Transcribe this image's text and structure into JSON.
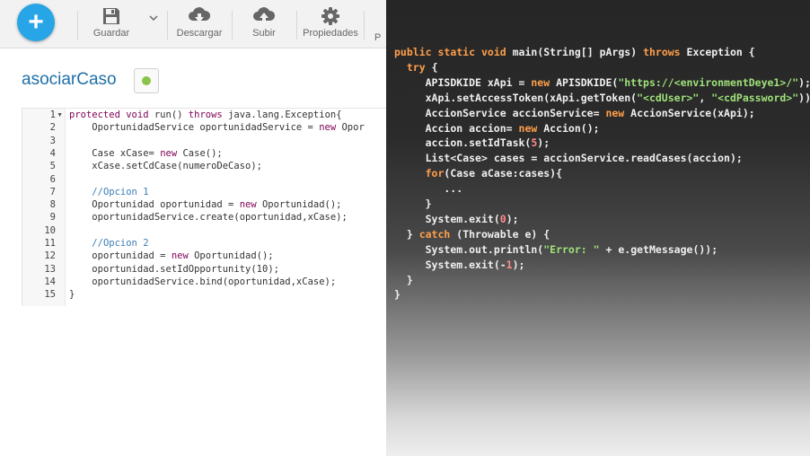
{
  "toolbar": {
    "add_symbol": "+",
    "save_label": "Guardar",
    "download_label": "Descargar",
    "upload_label": "Subir",
    "properties_label": "Propiedades",
    "cut_label": "P"
  },
  "page": {
    "title": "asociarCaso",
    "status_color": "#8bc34a"
  },
  "editor": {
    "line_numbers": [
      "1",
      "2",
      "3",
      "4",
      "5",
      "6",
      "7",
      "8",
      "9",
      "10",
      "11",
      "12",
      "13",
      "14",
      "15"
    ],
    "lines": [
      "protected void run() throws java.lang.Exception{",
      "    OportunidadService oportunidadService = new Opor",
      "",
      "    Case xCase= new Case();",
      "    xCase.setCdCase(numeroDeCaso);",
      "",
      "    //Opcion 1",
      "    Oportunidad oportunidad = new Oportunidad();",
      "    oportunidadService.create(oportunidad,xCase);",
      "",
      "    //Opcion 2",
      "    oportunidad = new Oportunidad();",
      "    oportunidad.setIdOpportunity(10);",
      "    oportunidadService.bind(oportunidad,xCase);",
      "}"
    ]
  },
  "overlay_code": {
    "lines": [
      "public static void main(String[] pArgs) throws Exception {",
      "  try {",
      "     APISDKIDE xApi = new APISDKIDE(\"https://<environmentDeye1>/\");",
      "     xApi.setAccessToken(xApi.getToken(\"<cdUser>\", \"<cdPassword>\"));",
      "     AccionService accionService= new AccionService(xApi);",
      "     Accion accion= new Accion();",
      "     accion.setIdTask(5);",
      "     List<Case> cases = accionService.readCases(accion);",
      "     for(Case aCase:cases){",
      "        ...",
      "     }",
      "     System.exit(0);",
      "  } catch (Throwable e) {",
      "     System.out.println(\"Error: \" + e.getMessage());",
      "     System.exit(-1);",
      "  }",
      "}"
    ]
  },
  "colors": {
    "accent": "#27a5e6",
    "title": "#1f6fa8",
    "keyword": "#7f0055",
    "comment": "#3b7db3"
  },
  "icons": [
    "add-icon",
    "save-icon",
    "dropdown-icon",
    "cloud-download-icon",
    "cloud-upload-icon",
    "gear-icon"
  ]
}
